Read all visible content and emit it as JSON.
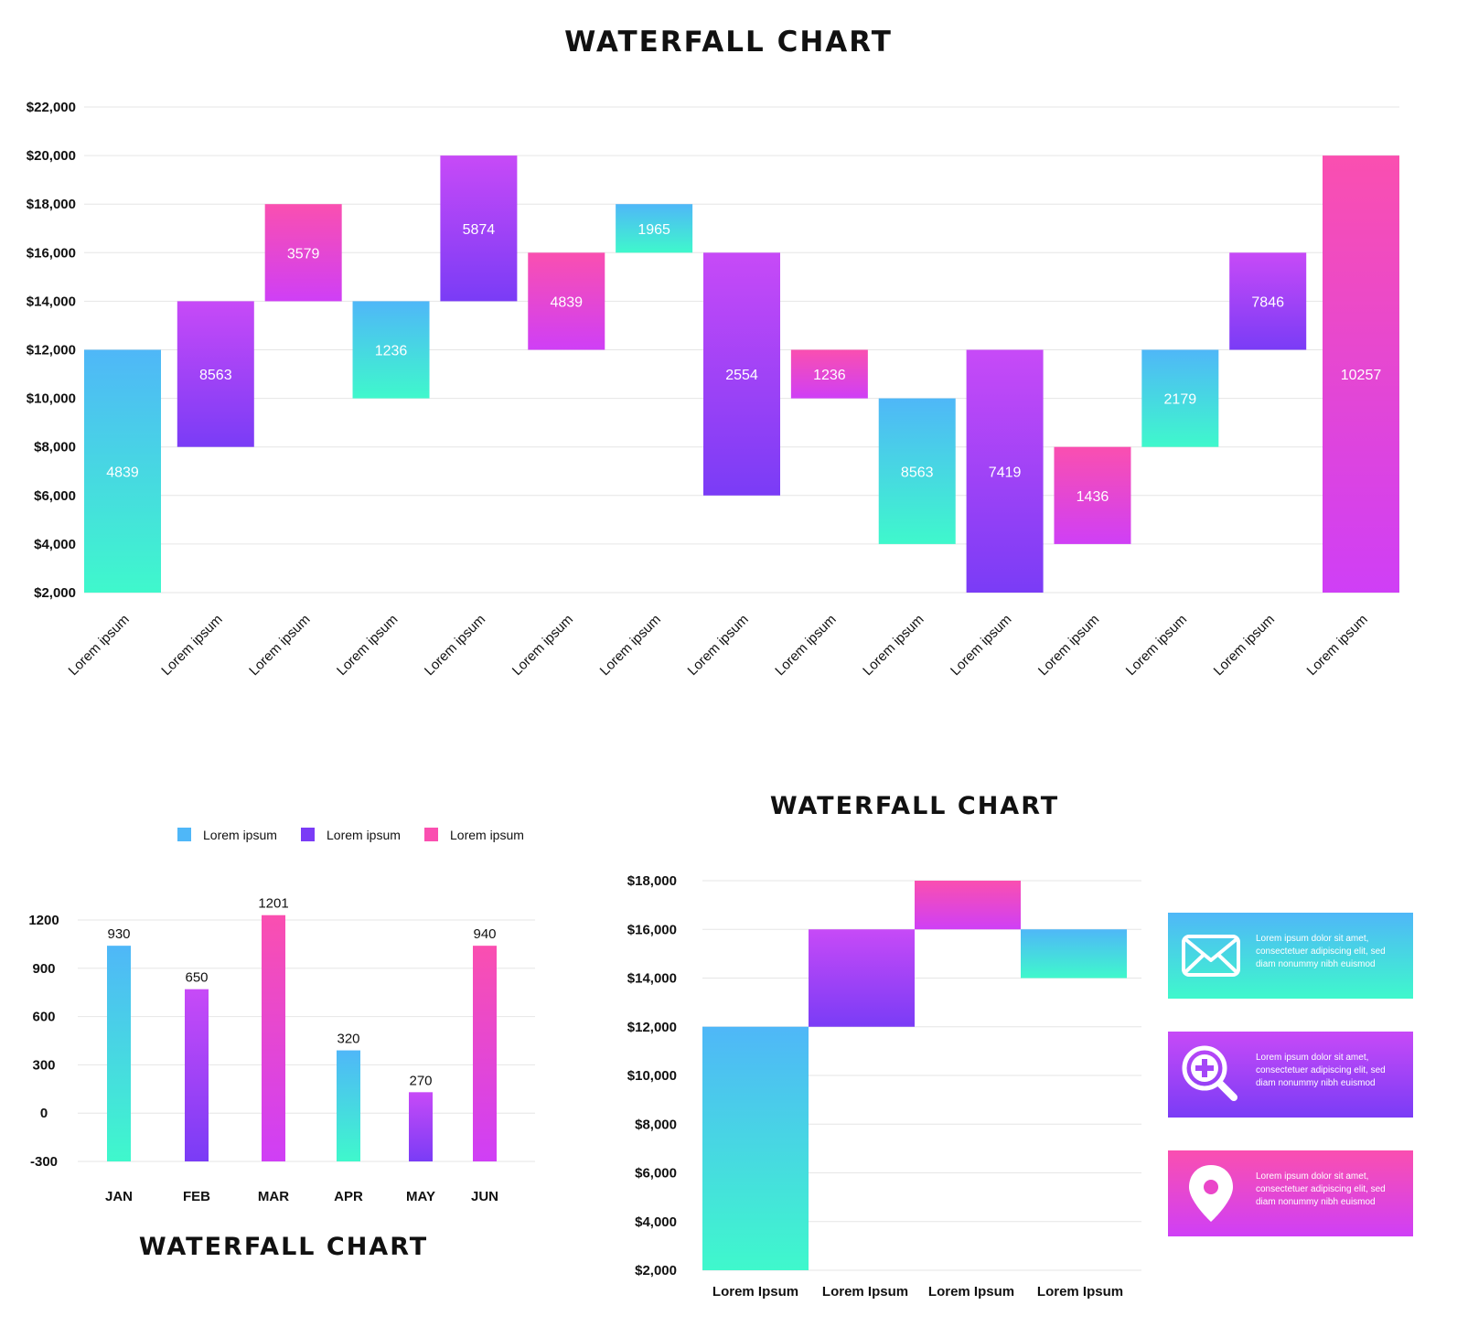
{
  "colors": {
    "teal": [
      "#4fb7f8",
      "#3ff8cc"
    ],
    "purple": [
      "#c74af7",
      "#7a3cf6"
    ],
    "pink": [
      "#fa4fb0",
      "#cf3ff6"
    ],
    "grid": "#e6e6e6",
    "text": "#111111"
  },
  "titles": {
    "main": "WATERFALL CHART",
    "bottom_left": "WATERFALL CHART",
    "bottom_right": "WATERFALL CHART"
  },
  "chart_data": [
    {
      "type": "bar",
      "subtype": "waterfall",
      "title": "WATERFALL CHART",
      "ylim": [
        2000,
        22000
      ],
      "yticks": [
        2000,
        4000,
        6000,
        8000,
        10000,
        12000,
        14000,
        16000,
        18000,
        20000,
        22000
      ],
      "ytick_labels": [
        "$2,000",
        "$4,000",
        "$6,000",
        "$8,000",
        "$10,000",
        "$12,000",
        "$14,000",
        "$16,000",
        "$18,000",
        "$20,000",
        "$22,000"
      ],
      "grid": true,
      "categories": [
        "Lorem ipsum",
        "Lorem ipsum",
        "Lorem ipsum",
        "Lorem ipsum",
        "Lorem ipsum",
        "Lorem ipsum",
        "Lorem ipsum",
        "Lorem ipsum",
        "Lorem ipsum",
        "Lorem ipsum",
        "Lorem ipsum",
        "Lorem ipsum",
        "Lorem ipsum",
        "Lorem ipsum",
        "Lorem ipsum"
      ],
      "bars": [
        {
          "start": 2000,
          "end": 12000,
          "label": "4839",
          "color": "teal"
        },
        {
          "start": 8000,
          "end": 14000,
          "label": "8563",
          "color": "purple"
        },
        {
          "start": 14000,
          "end": 18000,
          "label": "3579",
          "color": "pink"
        },
        {
          "start": 10000,
          "end": 14000,
          "label": "1236",
          "color": "teal"
        },
        {
          "start": 14000,
          "end": 20000,
          "label": "5874",
          "color": "purple"
        },
        {
          "start": 12000,
          "end": 16000,
          "label": "4839",
          "color": "pink"
        },
        {
          "start": 16000,
          "end": 18000,
          "label": "1965",
          "color": "teal"
        },
        {
          "start": 6000,
          "end": 16000,
          "label": "2554",
          "color": "purple"
        },
        {
          "start": 10000,
          "end": 12000,
          "label": "1236",
          "color": "pink"
        },
        {
          "start": 4000,
          "end": 10000,
          "label": "8563",
          "color": "teal"
        },
        {
          "start": 2000,
          "end": 12000,
          "label": "7419",
          "color": "purple"
        },
        {
          "start": 4000,
          "end": 8000,
          "label": "1436",
          "color": "pink"
        },
        {
          "start": 8000,
          "end": 12000,
          "label": "2179",
          "color": "teal"
        },
        {
          "start": 12000,
          "end": 16000,
          "label": "7846",
          "color": "purple"
        },
        {
          "start": 2000,
          "end": 20000,
          "label": "10257",
          "color": "pink"
        }
      ]
    },
    {
      "type": "bar",
      "ylim": [
        -300,
        1200
      ],
      "yticks": [
        -300,
        0,
        300,
        600,
        900,
        1200
      ],
      "grid": true,
      "legend": {
        "position": "top",
        "entries": [
          {
            "name": "Lorem ipsum",
            "color": "teal"
          },
          {
            "name": "Lorem ipsum",
            "color": "purple"
          },
          {
            "name": "Lorem ipsum",
            "color": "pink"
          }
        ]
      },
      "categories": [
        "JAN",
        "FEB",
        "MAR",
        "APR",
        "MAY",
        "JUN"
      ],
      "values": [
        930,
        650,
        1201,
        320,
        270,
        940
      ],
      "bar_tops": [
        1040,
        770,
        1230,
        390,
        130,
        1040
      ],
      "colors": [
        "teal",
        "purple",
        "pink",
        "teal",
        "purple",
        "pink"
      ],
      "title": "WATERFALL CHART"
    },
    {
      "type": "bar",
      "subtype": "waterfall",
      "title": "WATERFALL CHART",
      "ylim": [
        2000,
        18000
      ],
      "yticks": [
        2000,
        4000,
        6000,
        8000,
        10000,
        12000,
        14000,
        16000,
        18000
      ],
      "ytick_labels": [
        "$2,000",
        "$4,000",
        "$6,000",
        "$8,000",
        "$10,000",
        "$12,000",
        "$14,000",
        "$16,000",
        "$18,000"
      ],
      "grid": true,
      "categories": [
        "Lorem Ipsum",
        "Lorem Ipsum",
        "Lorem Ipsum",
        "Lorem Ipsum"
      ],
      "bars": [
        {
          "start": 2000,
          "end": 12000,
          "color": "teal"
        },
        {
          "start": 12000,
          "end": 16000,
          "color": "purple"
        },
        {
          "start": 16000,
          "end": 18000,
          "color": "pink"
        },
        {
          "start": 14000,
          "end": 16000,
          "color": "teal"
        }
      ]
    }
  ],
  "info_cards": [
    {
      "icon": "mail-icon",
      "color": "teal",
      "text": "Lorem ipsum dolor sit amet, consectetuer adipiscing elit, sed diam nonummy nibh euismod"
    },
    {
      "icon": "zoom-in-icon",
      "color": "purple",
      "text": "Lorem ipsum dolor sit amet, consectetuer adipiscing elit, sed diam nonummy nibh euismod"
    },
    {
      "icon": "location-pin-icon",
      "color": "pink",
      "text": "Lorem ipsum dolor sit amet, consectetuer adipiscing elit, sed diam nonummy nibh euismod"
    }
  ]
}
